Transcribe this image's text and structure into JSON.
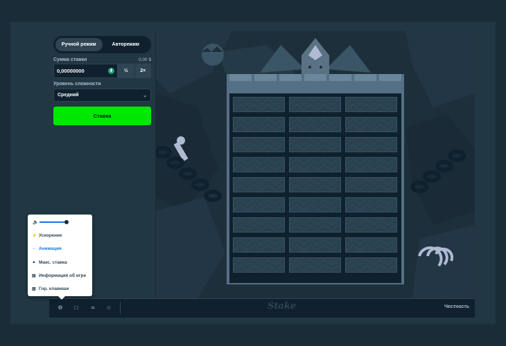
{
  "panel": {
    "mode_manual": "Ручной режим",
    "mode_auto": "Автоpежим",
    "bet_label": "Сумма ставки",
    "bet_usd": "0,00 $",
    "bet_value": "0,00000000",
    "coin_symbol": "₮",
    "half_label": "½",
    "double_label": "2×",
    "difficulty_label": "Уровень сложности",
    "difficulty_value": "Средний",
    "bet_button": "Ставка"
  },
  "settings_menu": {
    "volume_level": 0.85,
    "items": [
      {
        "label": "Ускорение",
        "icon": "lightning-icon"
      },
      {
        "label": "Анимация",
        "icon": "arrow-icon",
        "active": true
      },
      {
        "label": "Макс. ставка",
        "icon": "flame-icon"
      },
      {
        "label": "Информация об игре",
        "icon": "book-icon"
      },
      {
        "label": "Гор. клавиши",
        "icon": "keyboard-icon"
      }
    ]
  },
  "footer": {
    "logo": "Stake",
    "fairness": "Честность",
    "icons": [
      "gear-icon",
      "theatre-icon",
      "stats-icon",
      "star-icon"
    ]
  },
  "colors": {
    "accent_green": "#00e701",
    "bg": "#1a2c38",
    "panel": "#213743",
    "active_blue": "#1475e1"
  },
  "board": {
    "rows": 9,
    "cols": 3
  }
}
